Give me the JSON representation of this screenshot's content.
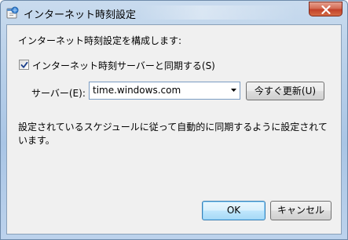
{
  "window": {
    "title": "インターネット時刻設定",
    "icon": "clock-globe-icon",
    "close_icon": "close-icon",
    "accent_color": "#c2422a"
  },
  "dialog": {
    "heading": "インターネット時刻設定を構成します:",
    "sync_checkbox": {
      "label": "インターネット時刻サーバーと同期する(S)",
      "checked": true
    },
    "server": {
      "label": "サーバー(E):",
      "value": "time.windows.com"
    },
    "update_now_label": "今すぐ更新(U)",
    "description": "設定されているスケジュールに従って自動的に同期するように設定されています。",
    "ok_label": "OK",
    "cancel_label": "キャンセル"
  }
}
